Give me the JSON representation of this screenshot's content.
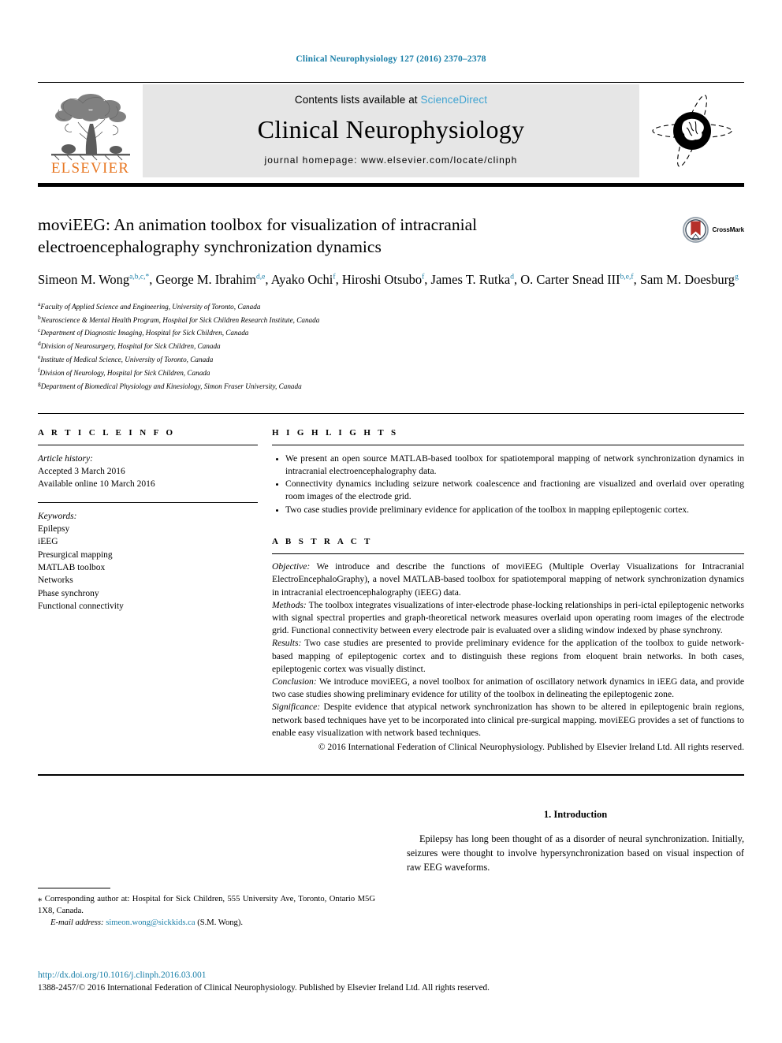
{
  "running_head": "Clinical Neurophysiology 127 (2016) 2370–2378",
  "masthead": {
    "contents_prefix": "Contents lists available at ",
    "sciencedirect": "ScienceDirect",
    "journal_title": "Clinical Neurophysiology",
    "homepage": "journal homepage: www.elsevier.com/locate/clinph",
    "publisher_wordmark": "ELSEVIER",
    "publisher_logo_icon": "elsevier-tree-icon",
    "journal_logo_icon": "journal-brain-orbit-icon"
  },
  "title": "moviEEG: An animation toolbox for visualization of intracranial electroencephalography synchronization dynamics",
  "crossmark": {
    "label": "CrossMark",
    "icon": "crossmark-badge-icon"
  },
  "authors": [
    {
      "name": "Simeon M. Wong",
      "sup": "a,b,c,*",
      "sep": ", "
    },
    {
      "name": "George M. Ibrahim",
      "sup": "d,e",
      "sep": ", "
    },
    {
      "name": "Ayako Ochi",
      "sup": "f",
      "sep": ", "
    },
    {
      "name": "Hiroshi Otsubo",
      "sup": "f",
      "sep": ", "
    },
    {
      "name": "James T. Rutka",
      "sup": "d",
      "sep": ", "
    },
    {
      "name": "O. Carter Snead III",
      "sup": "b,e,f",
      "sep": ", "
    },
    {
      "name": "Sam M. Doesburg",
      "sup": "g",
      "sep": ""
    }
  ],
  "affiliations": [
    {
      "mark": "a",
      "text": "Faculty of Applied Science and Engineering, University of Toronto, Canada"
    },
    {
      "mark": "b",
      "text": "Neuroscience & Mental Health Program, Hospital for Sick Children Research Institute, Canada"
    },
    {
      "mark": "c",
      "text": "Department of Diagnostic Imaging, Hospital for Sick Children, Canada"
    },
    {
      "mark": "d",
      "text": "Division of Neurosurgery, Hospital for Sick Children, Canada"
    },
    {
      "mark": "e",
      "text": "Institute of Medical Science, University of Toronto, Canada"
    },
    {
      "mark": "f",
      "text": "Division of Neurology, Hospital for Sick Children, Canada"
    },
    {
      "mark": "g",
      "text": "Department of Biomedical Physiology and Kinesiology, Simon Fraser University, Canada"
    }
  ],
  "article_info": {
    "heading": "A R T I C L E   I N F O",
    "history_label": "Article history:",
    "history_lines": [
      "Accepted 3 March 2016",
      "Available online 10 March 2016"
    ],
    "keywords_label": "Keywords:",
    "keywords": [
      "Epilepsy",
      "iEEG",
      "Presurgical mapping",
      "MATLAB toolbox",
      "Networks",
      "Phase synchrony",
      "Functional connectivity"
    ]
  },
  "highlights": {
    "heading": "H I G H L I G H T S",
    "items": [
      "We present an open source MATLAB-based toolbox for spatiotemporal mapping of network synchronization dynamics in intracranial electroencephalography data.",
      "Connectivity dynamics including seizure network coalescence and fractioning are visualized and overlaid over operating room images of the electrode grid.",
      "Two case studies provide preliminary evidence for application of the toolbox in mapping epileptogenic cortex."
    ]
  },
  "abstract": {
    "heading": "A B S T R A C T",
    "sections": [
      {
        "label": "Objective:",
        "text": " We introduce and describe the functions of moviEEG (Multiple Overlay Visualizations for Intracranial ElectroEncephaloGraphy), a novel MATLAB-based toolbox for spatiotemporal mapping of network synchronization dynamics in intracranial electroencephalography (iEEG) data."
      },
      {
        "label": "Methods:",
        "text": " The toolbox integrates visualizations of inter-electrode phase-locking relationships in peri-ictal epileptogenic networks with signal spectral properties and graph-theoretical network measures overlaid upon operating room images of the electrode grid. Functional connectivity between every electrode pair is evaluated over a sliding window indexed by phase synchrony."
      },
      {
        "label": "Results:",
        "text": " Two case studies are presented to provide preliminary evidence for the application of the toolbox to guide network-based mapping of epileptogenic cortex and to distinguish these regions from eloquent brain networks. In both cases, epileptogenic cortex was visually distinct."
      },
      {
        "label": "Conclusion:",
        "text": " We introduce moviEEG, a novel toolbox for animation of oscillatory network dynamics in iEEG data, and provide two case studies showing preliminary evidence for utility of the toolbox in delineating the epileptogenic zone."
      },
      {
        "label": "Significance:",
        "text": " Despite evidence that atypical network synchronization has shown to be altered in epileptogenic brain regions, network based techniques have yet to be incorporated into clinical pre-surgical mapping. moviEEG provides a set of functions to enable easy visualization with network based techniques."
      }
    ],
    "copyright": "© 2016 International Federation of Clinical Neurophysiology. Published by Elsevier Ireland Ltd. All rights reserved."
  },
  "footnote": {
    "star": "⁎",
    "corresponding": " Corresponding author at: Hospital for Sick Children, 555 University Ave, Toronto, Ontario M5G 1X8, Canada.",
    "email_label": "E-mail address:",
    "email": "simeon.wong@sickkids.ca",
    "email_suffix": " (S.M. Wong)."
  },
  "introduction": {
    "heading": "1. Introduction",
    "paragraph": "Epilepsy has long been thought of as a disorder of neural synchronization. Initially, seizures were thought to involve hypersynchronization based on visual inspection of raw EEG waveforms."
  },
  "page_footer": {
    "doi": "http://dx.doi.org/10.1016/j.clinph.2016.03.001",
    "issn_line": "1388-2457/© 2016 International Federation of Clinical Neurophysiology. Published by Elsevier Ireland Ltd. All rights reserved."
  },
  "colors": {
    "link_blue": "#1a7fa8",
    "sciencedirect_blue": "#3fa3d1",
    "elsevier_orange": "#E87722",
    "masthead_grey": "#e6e6e6",
    "crossmark_red": "#b5302a"
  }
}
